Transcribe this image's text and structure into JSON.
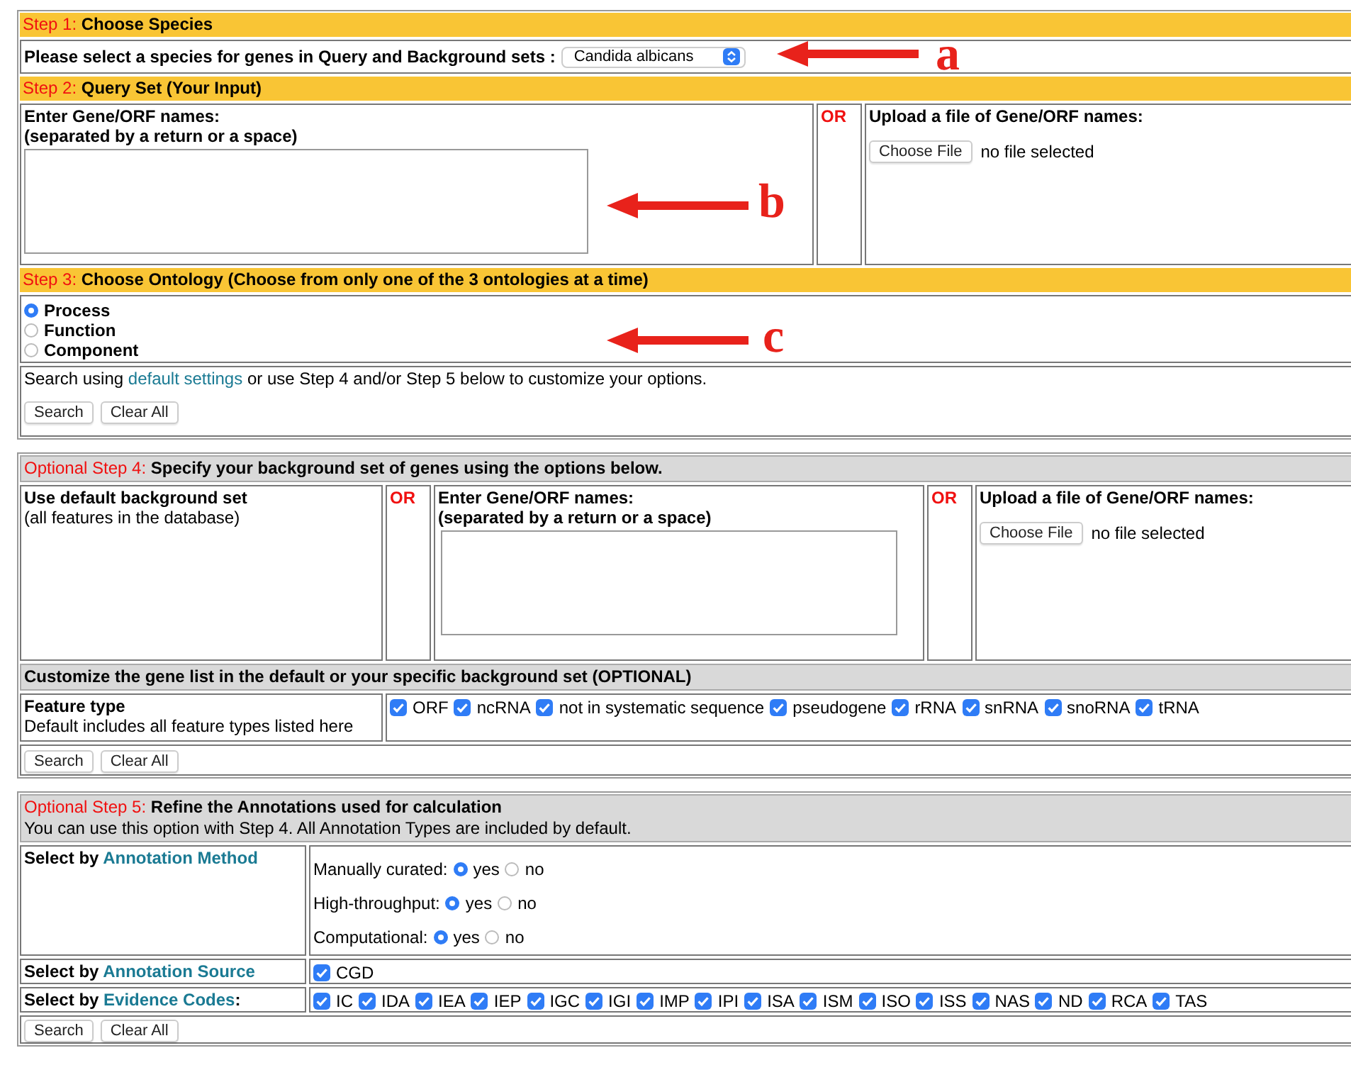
{
  "step1": {
    "step": "Step 1:",
    "title": "Choose Species",
    "prompt": "Please select a species for genes in Query and Background sets :",
    "species": "Candida albicans"
  },
  "step2": {
    "step": "Step 2:",
    "title": "Query Set (Your Input)",
    "enter_label": "Enter Gene/ORF names:",
    "enter_hint": "(separated by a return or a space)",
    "or": "OR",
    "upload_label": "Upload a file of Gene/ORF names:",
    "choose_button": "Choose File",
    "file_status": "no file selected"
  },
  "step3": {
    "step": "Step 3:",
    "title": "Choose Ontology (Choose from only one of the 3 ontologies at a time)",
    "ontologies": [
      {
        "label": "Process",
        "selected": true
      },
      {
        "label": "Function",
        "selected": false
      },
      {
        "label": "Component",
        "selected": false
      }
    ],
    "note": {
      "before": "Search using",
      "link": "default settings",
      "after": "or use Step 4 and/or Step 5 below to customize your options."
    },
    "buttons": [
      "Search",
      "Clear All"
    ]
  },
  "step4": {
    "step": "Optional Step 4:",
    "title": "Specify your background set of genes using the options below.",
    "default_label": "Use default background set",
    "default_hint": "(all features in the database)",
    "or_1": "OR",
    "enter_label": "Enter Gene/ORF names:",
    "enter_hint": "(separated by a return or a space)",
    "or_2": "OR",
    "upload_label": "Upload a file of Gene/ORF names:",
    "choose_button": "Choose File",
    "file_status": "no file selected",
    "customize_title": "Customize the gene list in the default or your specific background set (OPTIONAL)",
    "feature_label": "Feature type",
    "feature_hint": "Default includes all feature types listed here",
    "feature_types": [
      {
        "label": "ORF",
        "checked": true
      },
      {
        "label": "ncRNA",
        "checked": true
      },
      {
        "label": "not in systematic sequence",
        "checked": true
      },
      {
        "label": "pseudogene",
        "checked": true
      },
      {
        "label": "rRNA",
        "checked": true
      },
      {
        "label": "snRNA",
        "checked": true
      },
      {
        "label": "snoRNA",
        "checked": true
      },
      {
        "label": "tRNA",
        "checked": true
      }
    ],
    "buttons": [
      "Search",
      "Clear All"
    ]
  },
  "step5": {
    "step": "Optional Step 5:",
    "title": "Refine the Annotations used for calculation",
    "subtitle": "You can use this option with Step 4. All Annotation Types are included by default.",
    "method": {
      "prefix": "Select by",
      "link": "Annotation Method",
      "options": [
        {
          "label": "Manually curated:",
          "choices": [
            {
              "label": "yes",
              "selected": true
            },
            {
              "label": "no",
              "selected": false
            }
          ]
        },
        {
          "label": "High-throughput:",
          "choices": [
            {
              "label": "yes",
              "selected": true
            },
            {
              "label": "no",
              "selected": false
            }
          ]
        },
        {
          "label": "Computational:",
          "choices": [
            {
              "label": "yes",
              "selected": true
            },
            {
              "label": "no",
              "selected": false
            }
          ]
        }
      ]
    },
    "source": {
      "prefix": "Select by",
      "link": "Annotation Source",
      "items": [
        {
          "label": "CGD",
          "checked": true
        }
      ]
    },
    "evidence": {
      "prefix": "Select by",
      "link": "Evidence Codes",
      "suffix": ":",
      "items": [
        {
          "label": "IC",
          "checked": true
        },
        {
          "label": "IDA",
          "checked": true
        },
        {
          "label": "IEA",
          "checked": true
        },
        {
          "label": "IEP",
          "checked": true
        },
        {
          "label": "IGC",
          "checked": true
        },
        {
          "label": "IGI",
          "checked": true
        },
        {
          "label": "IMP",
          "checked": true
        },
        {
          "label": "IPI",
          "checked": true
        },
        {
          "label": "ISA",
          "checked": true
        },
        {
          "label": "ISM",
          "checked": true
        },
        {
          "label": "ISO",
          "checked": true
        },
        {
          "label": "ISS",
          "checked": true
        },
        {
          "label": "NAS",
          "checked": true
        },
        {
          "label": "ND",
          "checked": true
        },
        {
          "label": "RCA",
          "checked": true
        },
        {
          "label": "TAS",
          "checked": true
        }
      ]
    },
    "buttons": [
      "Search",
      "Clear All"
    ]
  },
  "annotations": [
    {
      "label": "a"
    },
    {
      "label": "b"
    },
    {
      "label": "c"
    }
  ]
}
